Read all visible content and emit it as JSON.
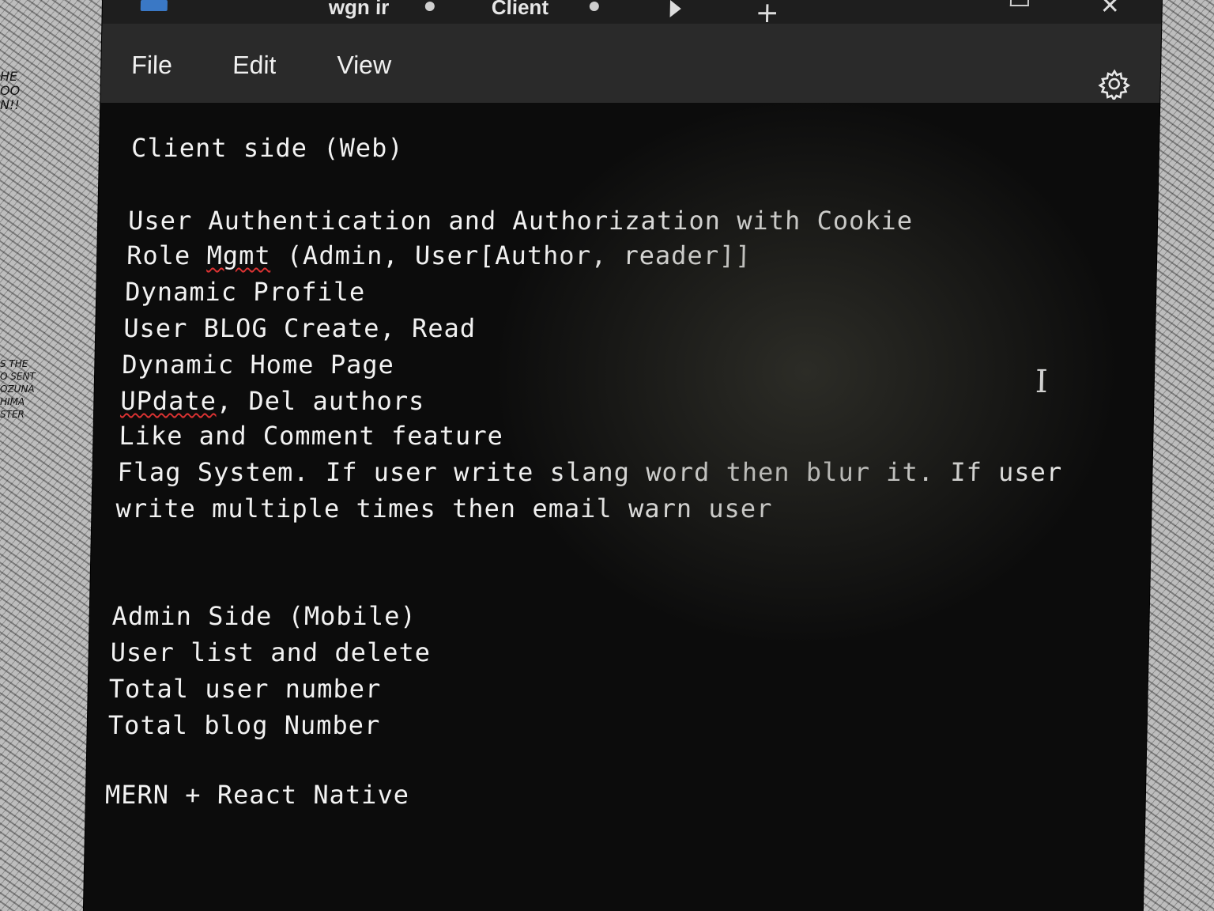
{
  "titlebar": {
    "tabs": [
      {
        "label": "wgn ir"
      },
      {
        "label": "Client"
      }
    ],
    "new_tab_icon": "plus-icon",
    "close_icon": "close-icon"
  },
  "menu": {
    "file": "File",
    "edit": "Edit",
    "view": "View",
    "settings_icon": "gear-icon"
  },
  "document": {
    "lines": [
      "Client side (Web)",
      "",
      "User Authentication and Authorization with Cookie",
      "Role Mgmt (Admin, User[Author, reader]]",
      "Dynamic Profile",
      "User BLOG Create, Read",
      "Dynamic Home Page",
      "UPdate, Del authors",
      "Like and Comment feature",
      "Flag System. If user write slang word then blur it. If user",
      "write multiple times then email warn user",
      "",
      "",
      "Admin Side (Mobile)",
      "User list and delete",
      "Total user number",
      "Total blog Number",
      "",
      "MERN + React Native"
    ],
    "misspelled": [
      "Mgmt",
      "UPdate"
    ]
  },
  "background_text": {
    "left_top": "HE\nOO\nN!!",
    "left_mid": "S THE\nO SENT\nOZUNA\nHIMA\nSTER"
  }
}
